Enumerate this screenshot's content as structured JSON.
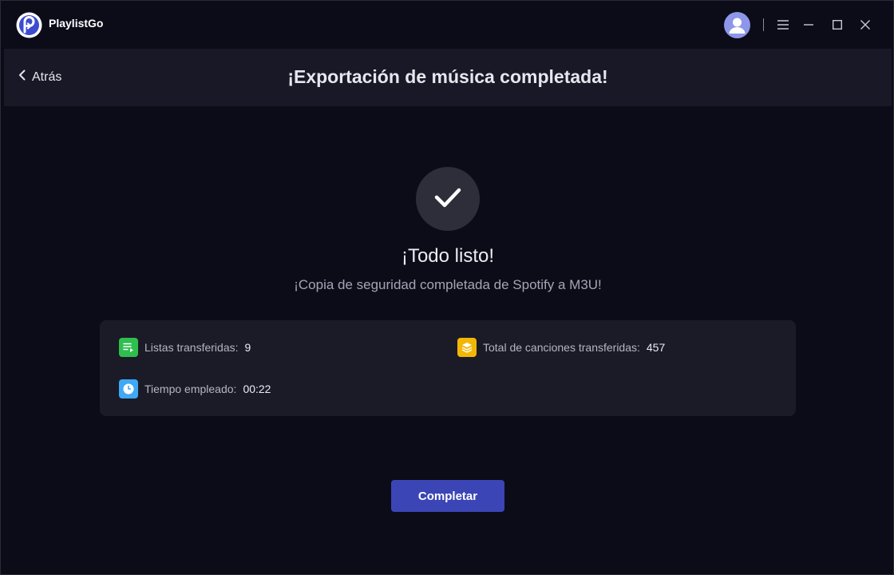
{
  "app": {
    "name": "PlaylistGo"
  },
  "header": {
    "back_label": "Atrás",
    "title": "¡Exportación de música completada!"
  },
  "result": {
    "title": "¡Todo listo!",
    "subtitle": "¡Copia de seguridad completada de Spotify a M3U!"
  },
  "stats": {
    "playlists_label": "Listas transferidas:",
    "playlists_value": "9",
    "songs_label": "Total de canciones transferidas:",
    "songs_value": "457",
    "time_label": "Tiempo empleado:",
    "time_value": "00:22"
  },
  "actions": {
    "complete_label": "Completar"
  },
  "icons": {
    "logo": "playlistgo-logo-icon",
    "avatar": "user-avatar-icon",
    "menu": "hamburger-menu-icon",
    "minimize": "minimize-icon",
    "maximize": "maximize-icon",
    "close": "close-icon",
    "back": "chevron-left-icon",
    "check": "checkmark-icon",
    "playlist": "playlist-icon",
    "songs": "layers-icon",
    "time": "clock-icon"
  },
  "colors": {
    "background": "#0c0c19",
    "panel": "#1b1b28",
    "accent_button": "#3b45b5",
    "playlist_icon": "#2fbf4e",
    "songs_icon": "#f2b705",
    "time_icon": "#3fa9f5"
  }
}
